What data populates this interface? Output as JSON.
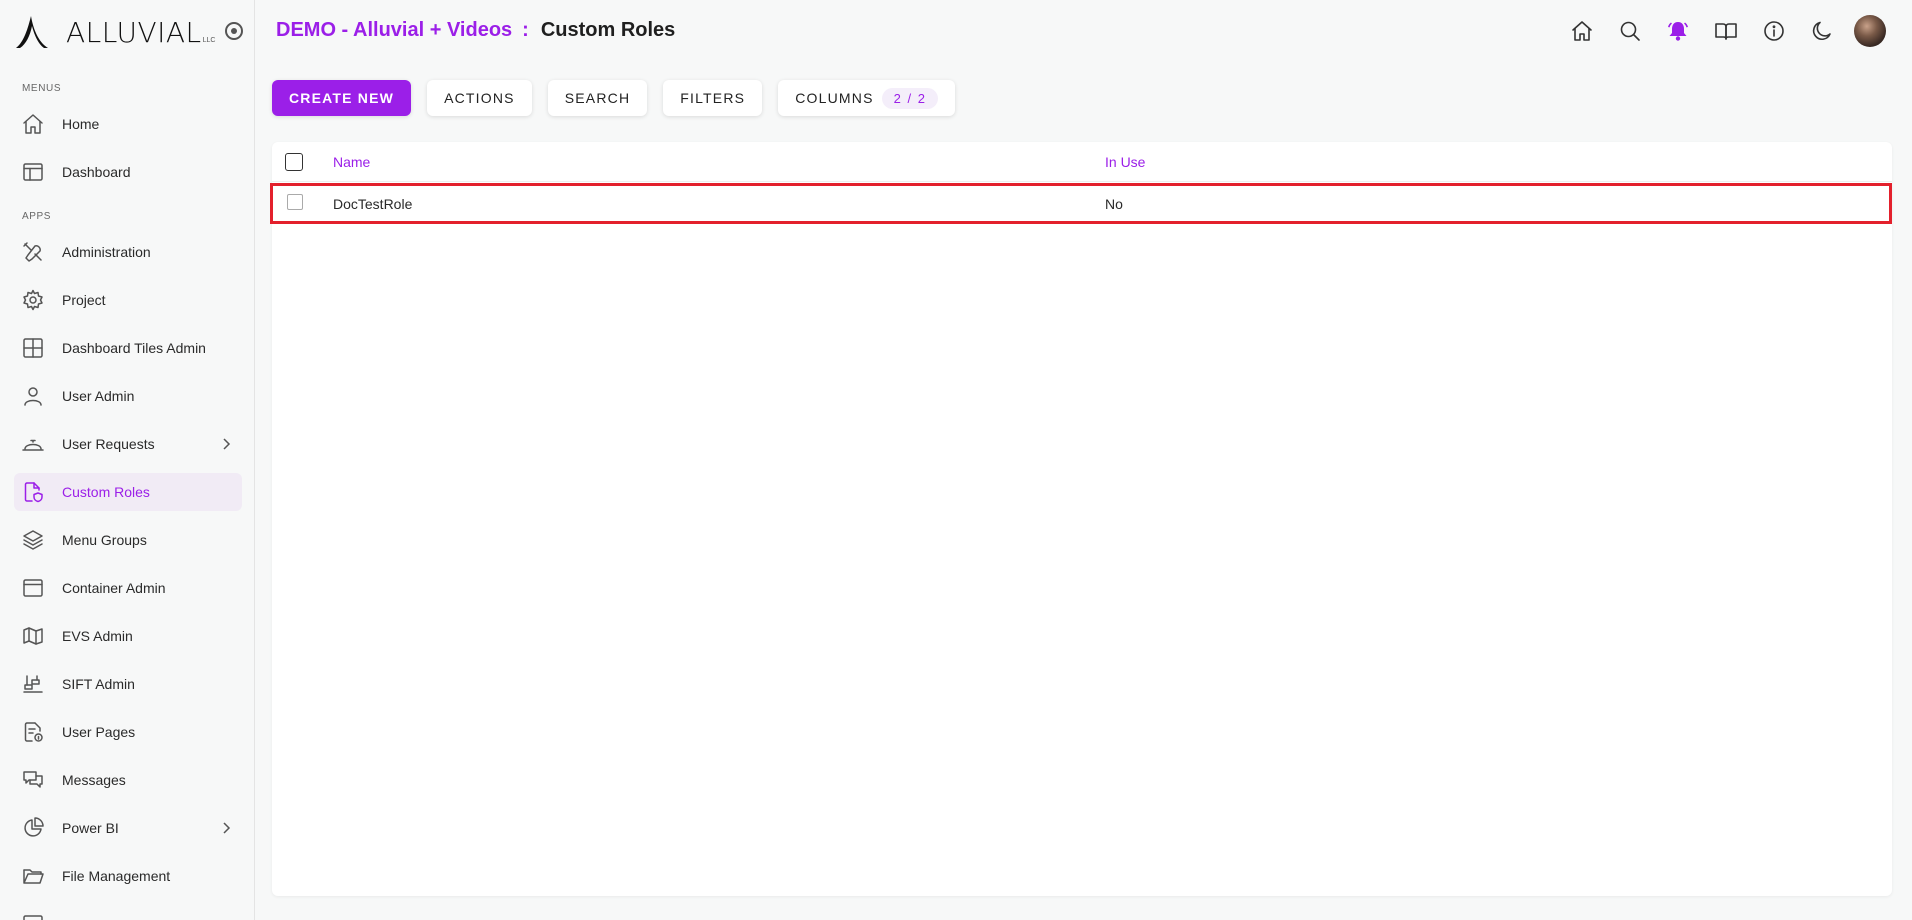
{
  "brand": {
    "name": "ALLUVIAL",
    "tm": "LLC"
  },
  "sidebar": {
    "menus_label": "MENUS",
    "apps_label": "APPS",
    "menus": [
      {
        "label": "Home",
        "icon": "home-icon"
      },
      {
        "label": "Dashboard",
        "icon": "dashboard-icon"
      }
    ],
    "apps": [
      {
        "label": "Administration",
        "icon": "tools-icon"
      },
      {
        "label": "Project",
        "icon": "gear-icon"
      },
      {
        "label": "Dashboard Tiles Admin",
        "icon": "grid-icon"
      },
      {
        "label": "User Admin",
        "icon": "user-icon"
      },
      {
        "label": "User Requests",
        "icon": "bell-service-icon",
        "has_children": true
      },
      {
        "label": "Custom Roles",
        "icon": "file-shield-icon",
        "active": true
      },
      {
        "label": "Menu Groups",
        "icon": "layers-icon"
      },
      {
        "label": "Container Admin",
        "icon": "window-icon"
      },
      {
        "label": "EVS Admin",
        "icon": "map-icon"
      },
      {
        "label": "SIFT Admin",
        "icon": "sift-icon"
      },
      {
        "label": "User Pages",
        "icon": "file-info-icon"
      },
      {
        "label": "Messages",
        "icon": "chat-icon"
      },
      {
        "label": "Power BI",
        "icon": "pie-chart-icon",
        "has_children": true
      },
      {
        "label": "File Management",
        "icon": "folder-icon"
      }
    ]
  },
  "header": {
    "app_name": "DEMO - Alluvial + Videos",
    "separator": ":",
    "page_title": "Custom Roles"
  },
  "top_icons": [
    "home-icon",
    "search-icon",
    "notification-bell-icon",
    "book-icon",
    "info-icon",
    "moon-icon",
    "avatar"
  ],
  "toolbar": {
    "create_label": "CREATE NEW",
    "actions_label": "ACTIONS",
    "search_label": "SEARCH",
    "filters_label": "FILTERS",
    "columns_label": "COLUMNS",
    "columns_badge": "2 / 2"
  },
  "table": {
    "columns": [
      "Name",
      "In Use"
    ],
    "rows": [
      {
        "name": "DocTestRole",
        "in_use": "No"
      }
    ]
  },
  "colors": {
    "accent": "#9b1fe8",
    "highlight_border": "#e3202c",
    "active_bg": "#f1ebf5"
  }
}
